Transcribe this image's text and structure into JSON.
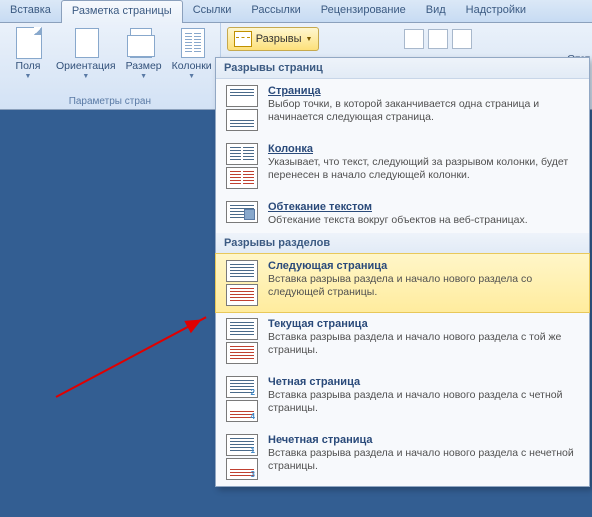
{
  "tabs": {
    "insert": "Вставка",
    "layout": "Разметка страницы",
    "links": "Ссылки",
    "mail": "Рассылки",
    "review": "Рецензирование",
    "view": "Вид",
    "addins": "Надстройки"
  },
  "ribbon": {
    "fields": "Поля",
    "orientation": "Ориентация",
    "size": "Размер",
    "columns": "Колонки",
    "breaks": "Разрывы",
    "group_label": "Параметры стран",
    "indent": "Отст"
  },
  "menu": {
    "page_breaks_header": "Разрывы страниц",
    "section_breaks_header": "Разрывы разделов",
    "items": {
      "page": {
        "title": "Страница",
        "desc": "Выбор точки, в которой заканчивается одна страница и начинается следующая страница."
      },
      "column": {
        "title": "Колонка",
        "desc": "Указывает, что текст, следующий за разрывом колонки, будет перенесен в начало следующей колонки."
      },
      "wrap": {
        "title": "Обтекание текстом",
        "desc": "Обтекание текста вокруг объектов на веб-страницах."
      },
      "next": {
        "title": "Следующая страница",
        "desc": "Вставка разрыва раздела и начало нового раздела со следующей страницы."
      },
      "cont": {
        "title": "Текущая страница",
        "desc": "Вставка разрыва раздела и начало нового раздела с той же страницы."
      },
      "even": {
        "title": "Четная страница",
        "desc": "Вставка разрыва раздела и начало нового раздела с четной страницы."
      },
      "odd": {
        "title": "Нечетная страница",
        "desc": "Вставка разрыва раздела и начало нового раздела с нечетной страницы."
      }
    }
  }
}
